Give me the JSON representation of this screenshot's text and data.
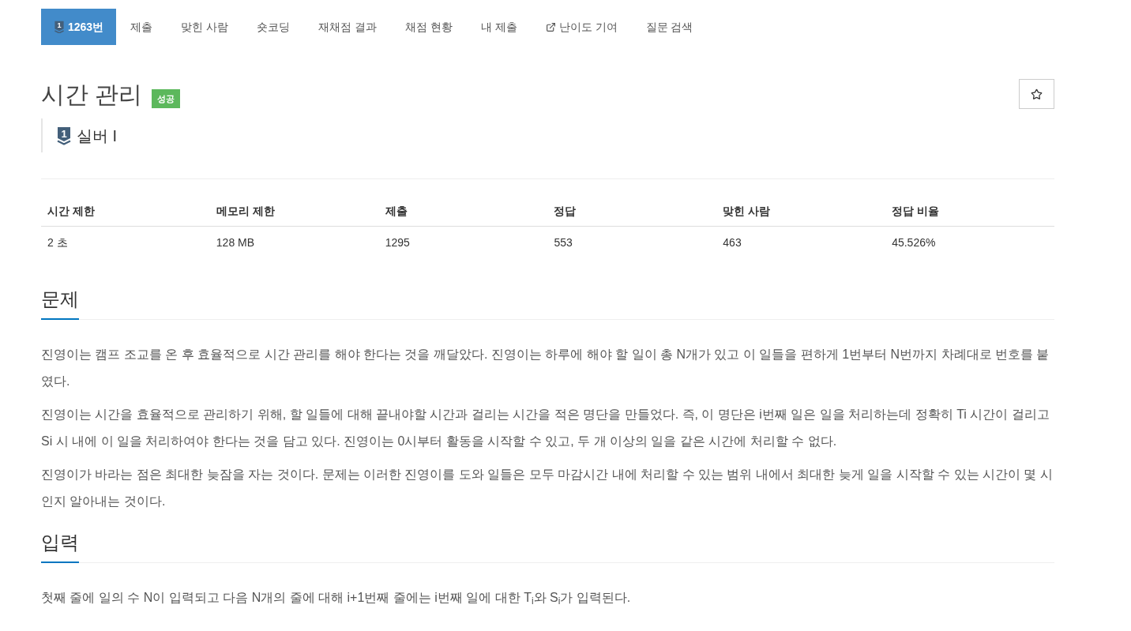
{
  "nav": {
    "tabs": [
      {
        "label": "1263번",
        "kind": "problem",
        "tier_number": "1",
        "selected": true
      },
      {
        "label": "제출",
        "kind": "plain",
        "selected": false
      },
      {
        "label": "맞힌 사람",
        "kind": "plain",
        "selected": false
      },
      {
        "label": "숏코딩",
        "kind": "plain",
        "selected": false
      },
      {
        "label": "재채점 결과",
        "kind": "plain",
        "selected": false
      },
      {
        "label": "채점 현황",
        "kind": "plain",
        "selected": false
      },
      {
        "label": "내 제출",
        "kind": "plain",
        "selected": false
      },
      {
        "label": "난이도 기여",
        "kind": "external",
        "selected": false
      },
      {
        "label": "질문 검색",
        "kind": "plain",
        "selected": false
      }
    ]
  },
  "title": "시간 관리",
  "status_badge": "성공",
  "favorite": {
    "starred": false
  },
  "tier": {
    "number": "1",
    "label": "실버 I"
  },
  "stats": {
    "columns": [
      "시간 제한",
      "메모리 제한",
      "제출",
      "정답",
      "맞힌 사람",
      "정답 비율"
    ],
    "rows": [
      [
        "2 초",
        "128 MB",
        "1295",
        "553",
        "463",
        "45.526%"
      ]
    ]
  },
  "sections": [
    {
      "heading": "문제",
      "paragraphs": [
        "진영이는 캠프 조교를 온 후 효율적으로 시간 관리를 해야 한다는 것을 깨달았다. 진영이는 하루에 해야 할 일이 총 N개가 있고 이 일들을 편하게 1번부터 N번까지 차례대로 번호를 붙였다.",
        "진영이는 시간을 효율적으로 관리하기 위해, 할 일들에 대해 끝내야할 시간과 걸리는 시간을 적은 명단을 만들었다. 즉, 이 명단은 i번째 일은 일을 처리하는데 정확히 Ti 시간이 걸리고 Si 시 내에 이 일을 처리하여야 한다는 것을 담고 있다. 진영이는 0시부터 활동을 시작할 수 있고, 두 개 이상의 일을 같은 시간에 처리할 수 없다.",
        "진영이가 바라는 점은 최대한 늦잠을 자는 것이다. 문제는 이러한 진영이를 도와 일들은 모두 마감시간 내에 처리할 수 있는 범위 내에서 최대한 늦게 일을 시작할 수 있는 시간이 몇 시인지 알아내는 것이다."
      ]
    },
    {
      "heading": "입력",
      "paragraphs": [
        "첫째 줄에 일의 수 N이 입력되고 다음 N개의 줄에 대해 i+1번째 줄에는 i번째 일에 대한 T$_{i}$와 S$_{i}$가 입력된다."
      ]
    }
  ]
}
